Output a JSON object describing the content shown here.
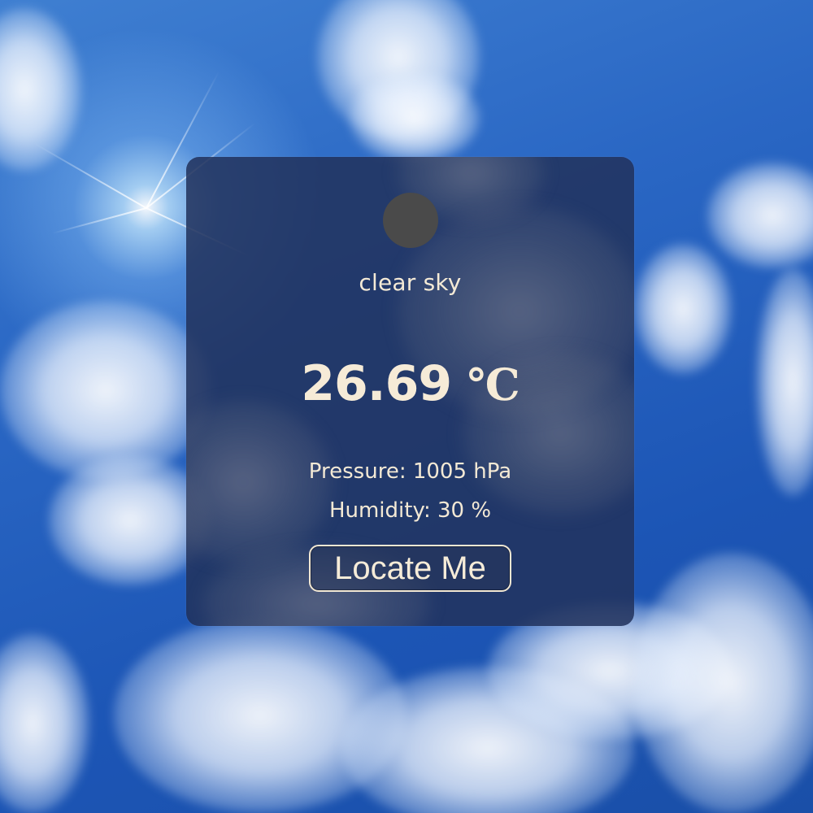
{
  "weather": {
    "description": "clear sky",
    "temperature_value": "26.69",
    "temperature_unit": "℃",
    "pressure": "Pressure: 1005 hPa",
    "humidity": "Humidity: 30 %",
    "icon": "weather-condition-icon"
  },
  "actions": {
    "locate_label": "Locate Me"
  },
  "colors": {
    "card_background": "#22325c",
    "text": "#f5ecd9",
    "sky": "#1e5bb8"
  }
}
